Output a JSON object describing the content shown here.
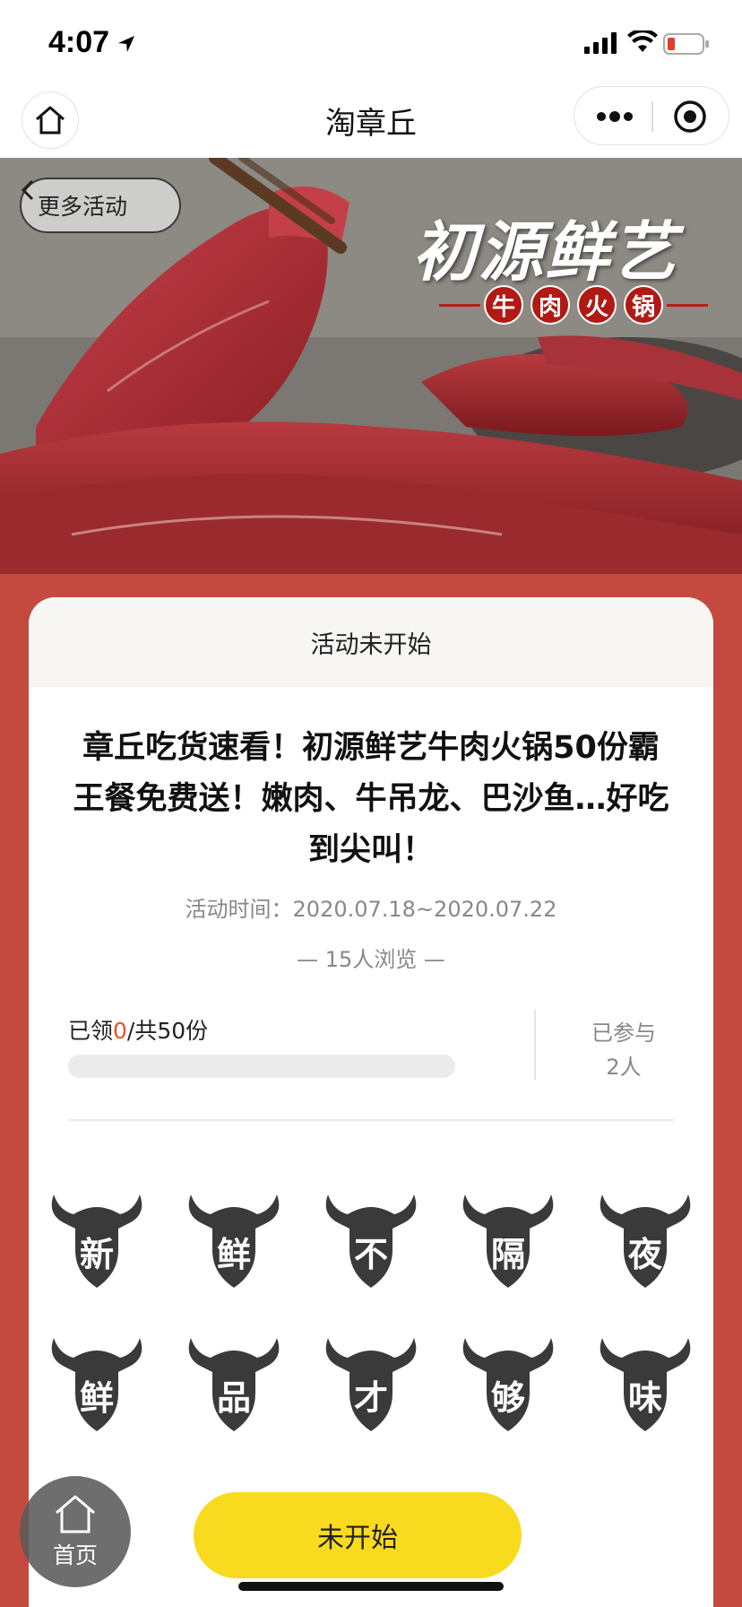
{
  "status_bar": {
    "time": "4:07"
  },
  "nav": {
    "title": "淘章丘"
  },
  "banner": {
    "back_label": "更多活动",
    "brand_title": "初源鲜艺",
    "brand_subtitle_chars": [
      "牛",
      "肉",
      "火",
      "锅"
    ]
  },
  "activity": {
    "state": "活动未开始",
    "headline": "章丘吃货速看！初源鲜艺牛肉火锅50份霸王餐免费送！嫩肉、牛吊龙、巴沙鱼…好吃到尖叫！",
    "period": "活动时间：2020.07.18~2020.07.22",
    "views": "— 15人浏览 —",
    "claimed_prefix": "已领",
    "claimed_count": "0",
    "claimed_suffix": "/共50份",
    "progress_fraction": 0.0,
    "joined_label": "已参与",
    "joined_count": "2人"
  },
  "bulls": [
    "新",
    "鲜",
    "不",
    "隔",
    "夜",
    "鲜",
    "品",
    "才",
    "够",
    "味"
  ],
  "bottom": {
    "home_label": "首页",
    "cta_label": "未开始"
  },
  "colors": {
    "page_red": "#c44a3f",
    "cta_yellow": "#f8db1e",
    "highlight": "#e8502c",
    "bull": "#3a3a3a"
  }
}
